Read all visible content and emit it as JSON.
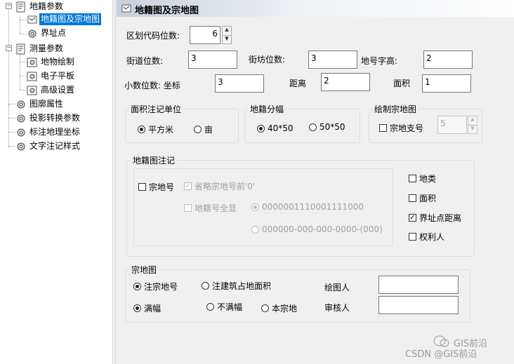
{
  "tree": {
    "root1": "地籍参数",
    "child1": "地籍图及宗地图",
    "child2": "界址点",
    "root2": "测量参数",
    "child3": "地物绘制",
    "child4": "电子平板",
    "child5": "高级设置",
    "root3": "图廓属性",
    "root4": "投影转换参数",
    "root5": "标注地理坐标",
    "root6": "文字注记样式"
  },
  "header": {
    "title": "地籍图及宗地图"
  },
  "params": {
    "district_label": "区划代码位数:",
    "district_value": "6",
    "street_label": "街道位数:",
    "street_value": "3",
    "block_label": "街坊位数:",
    "block_value": "3",
    "lotfont_label": "地号字高:",
    "lotfont_value": "2",
    "decimal_label": "小数位数: 坐标",
    "coord_value": "3",
    "distance_label": "距离",
    "distance_value": "2",
    "area_label": "面积",
    "area_value": "1"
  },
  "area_unit": {
    "title": "面积注记单位",
    "opt1": "平方米",
    "opt2": "亩",
    "selected": "平方米"
  },
  "cadastral_split": {
    "title": "地籍分幅",
    "opt1": "40*50",
    "opt2": "50*50",
    "selected": "40*50"
  },
  "draw_parcel": {
    "title": "绘制宗地图",
    "branch_label": "宗地支号",
    "branch_value": "5"
  },
  "annotation": {
    "title": "地籍图注记",
    "lot_number": "宗地号",
    "omit_prefix": "省略宗地号前'0'",
    "full_display": "地籍号全显",
    "format1": "0000001110001111000",
    "format2": "000000-000-000-0000-(000)",
    "land_type": "地类",
    "area": "面积",
    "boundary_distance": "界址点距离",
    "owner": "权利人"
  },
  "parcel_map": {
    "title": "宗地图",
    "note_lot": "注宗地号",
    "note_building_area": "注建筑占地面积",
    "full": "满幅",
    "not_full": "不满幅",
    "this_parcel": "本宗地",
    "drafter_label": "绘图人",
    "drafter_value": "",
    "reviewer_label": "审核人",
    "reviewer_value": ""
  },
  "watermark": {
    "line1": "GIS前沿",
    "line2": "CSDN @GIS前沿"
  }
}
